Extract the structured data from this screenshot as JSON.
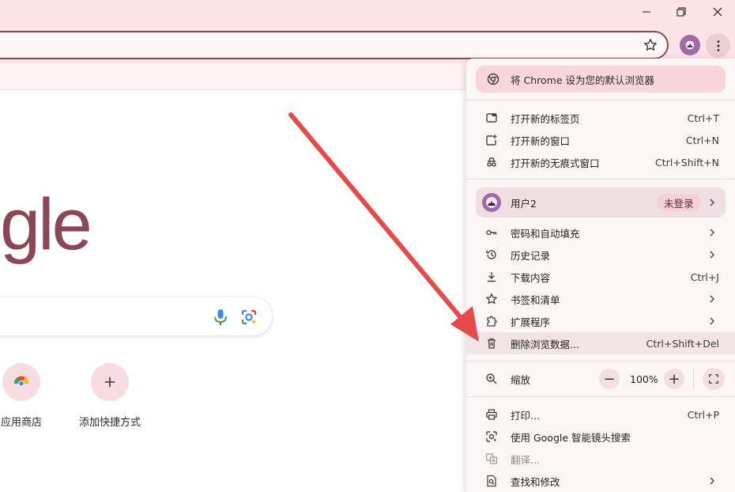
{
  "window": {
    "minimize_icon": "minimize-icon",
    "restore_icon": "restore-icon",
    "close_icon": "close-icon"
  },
  "ntp": {
    "logo_partial": "gle",
    "shortcuts": [
      {
        "label": "应用商店"
      },
      {
        "label": "添加快捷方式"
      }
    ]
  },
  "menu": {
    "default_banner": "将 Chrome 设为您的默认浏览器",
    "items1": [
      {
        "label": "打开新的标签页",
        "shortcut": "Ctrl+T"
      },
      {
        "label": "打开新的窗口",
        "shortcut": "Ctrl+N"
      },
      {
        "label": "打开新的无痕式窗口",
        "shortcut": "Ctrl+Shift+N"
      }
    ],
    "profile": {
      "name": "用户2",
      "status": "未登录"
    },
    "items2": [
      {
        "label": "密码和自动填充"
      },
      {
        "label": "历史记录"
      },
      {
        "label": "下载内容",
        "shortcut": "Ctrl+J"
      },
      {
        "label": "书签和清单"
      },
      {
        "label": "扩展程序"
      },
      {
        "label": "删除浏览数据...",
        "shortcut": "Ctrl+Shift+Del"
      }
    ],
    "zoom": {
      "label": "缩放",
      "minus": "−",
      "value": "100%",
      "plus": "+"
    },
    "items3": [
      {
        "label": "打印...",
        "shortcut": "Ctrl+P"
      },
      {
        "label": "使用 Google 智能镜头搜索"
      },
      {
        "label": "翻译..."
      },
      {
        "label": "查找和修改"
      }
    ]
  },
  "colors": {
    "arrow": "#e84a4a",
    "accent": "#8c4756",
    "titlebar": "#fde4e7"
  }
}
